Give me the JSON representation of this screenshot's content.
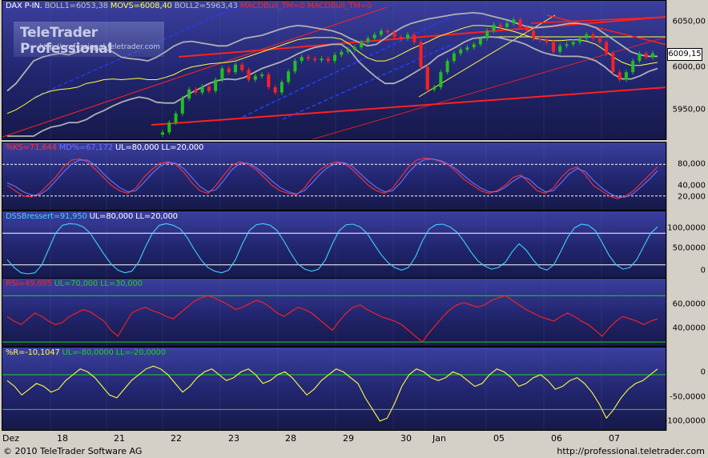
{
  "chart_data": [
    {
      "type": "candlestick",
      "header": {
        "symbol": "DAX P-IN.",
        "boll1": "BOLL1=6053,38",
        "movs": "MOVS=6008,40",
        "boll2": "BOLL2=5963,43",
        "macd1": "MACDBull_TM=0",
        "macd2": "MACDBull_TM=0"
      },
      "last_price": "6009,15",
      "y_ticks": [
        "6050,00",
        "6000,00",
        "5950,00"
      ],
      "ylim": [
        5900,
        6065
      ],
      "close": [
        5905,
        5918,
        5930,
        5950,
        5962,
        5958,
        5966,
        5960,
        5975,
        5990,
        5985,
        5995,
        5988,
        5975,
        5980,
        5982,
        5965,
        5958,
        5972,
        5986,
        6000,
        6005,
        6003,
        6001,
        6003,
        6000,
        6008,
        6012,
        6015,
        6018,
        6025,
        6030,
        6035,
        6040,
        6038,
        6032,
        6030,
        6035,
        6025,
        5992,
        5962,
        5965,
        5985,
        6000,
        6010,
        6015,
        6018,
        6022,
        6030,
        6040,
        6048,
        6045,
        6050,
        6055,
        6045,
        6040,
        6030,
        6028,
        6025,
        6012,
        6020,
        6022,
        6025,
        6030,
        6035,
        6030,
        6025,
        6010,
        5985,
        5975,
        5985,
        6000,
        6010,
        6005,
        6010
      ],
      "boll_upper": [
        5960,
        5970,
        5985,
        6000,
        6005,
        6008,
        6010,
        6008,
        6012,
        6018,
        6015,
        6016,
        6012,
        6005,
        6003,
        6002,
        6000,
        6005,
        6012,
        6020,
        6025,
        6026,
        6024,
        6022,
        6020,
        6020,
        6025,
        6030,
        6032,
        6034,
        6038,
        6042,
        6045,
        6047,
        6046,
        6044,
        6042,
        6040,
        6036,
        6030,
        6025,
        6020,
        6022,
        6030,
        6038,
        6045,
        6050,
        6053,
        6056,
        6058,
        6060,
        6062,
        6063,
        6064,
        6063,
        6060,
        6057,
        6054,
        6050,
        6046,
        6044,
        6045,
        6046,
        6048,
        6050,
        6050,
        6048,
        6044,
        6036,
        6028,
        6020,
        6012,
        6008,
        6006,
        6006
      ],
      "boll_middle": [
        5930,
        5935,
        5942,
        5950,
        5956,
        5960,
        5962,
        5963,
        5965,
        5970,
        5972,
        5975,
        5976,
        5975,
        5976,
        5977,
        5975,
        5975,
        5978,
        5982,
        5988,
        5992,
        5994,
        5996,
        5997,
        5998,
        6000,
        6004,
        6008,
        6012,
        6016,
        6020,
        6024,
        6028,
        6030,
        6031,
        6031,
        6031,
        6029,
        6022,
        6012,
        6004,
        6000,
        6000,
        6004,
        6010,
        6016,
        6021,
        6026,
        6032,
        6036,
        6040,
        6044,
        6047,
        6047,
        6046,
        6044,
        6041,
        6038,
        6034,
        6030,
        6028,
        6027,
        6027,
        6028,
        6028,
        6026,
        6022,
        6014,
        6005,
        5998,
        5994,
        5994,
        5996,
        5998
      ],
      "boll_lower": [
        5900,
        5900,
        5900,
        5900,
        5907,
        5912,
        5914,
        5918,
        5918,
        5922,
        5929,
        5934,
        5940,
        5945,
        5949,
        5952,
        5950,
        5945,
        5944,
        5944,
        5951,
        5958,
        5964,
        5970,
        5974,
        5976,
        5975,
        5978,
        5984,
        5990,
        5994,
        5998,
        6003,
        6009,
        6014,
        6018,
        6020,
        6022,
        6022,
        6014,
        5999,
        5988,
        5978,
        5970,
        5970,
        5975,
        5982,
        5989,
        5996,
        6006,
        6012,
        6018,
        6025,
        6030,
        6031,
        6032,
        6031,
        6028,
        6026,
        6022,
        6016,
        6011,
        6008,
        6006,
        6006,
        6006,
        6004,
        6000,
        5992,
        5982,
        5976,
        5976,
        5980,
        5986,
        5990
      ]
    },
    {
      "type": "line",
      "header": {
        "ks": "%KS=71,644",
        "md": "MD%=67,172",
        "ul": "UL=80,000",
        "ll": "LL=20,000"
      },
      "y_ticks": [
        "80,000",
        "40,000",
        "20,000"
      ],
      "ylim": [
        0,
        100
      ],
      "series": [
        {
          "name": "%KS",
          "color": "#ff3030",
          "values": [
            40,
            30,
            20,
            18,
            25,
            40,
            55,
            75,
            88,
            90,
            85,
            70,
            55,
            40,
            30,
            25,
            35,
            55,
            70,
            82,
            85,
            80,
            65,
            45,
            30,
            25,
            40,
            60,
            78,
            85,
            80,
            70,
            55,
            40,
            30,
            25,
            22,
            35,
            55,
            70,
            80,
            85,
            82,
            70,
            55,
            40,
            30,
            25,
            35,
            55,
            75,
            88,
            92,
            90,
            85,
            78,
            65,
            50,
            40,
            30,
            25,
            30,
            40,
            55,
            60,
            45,
            30,
            25,
            35,
            55,
            70,
            75,
            60,
            40,
            30,
            20,
            15,
            20,
            30,
            45,
            60,
            75
          ]
        },
        {
          "name": "MD%",
          "color": "#7070ff",
          "values": [
            45,
            38,
            28,
            22,
            22,
            32,
            48,
            65,
            80,
            88,
            88,
            78,
            62,
            48,
            36,
            28,
            30,
            45,
            62,
            76,
            83,
            82,
            72,
            55,
            38,
            28,
            32,
            50,
            70,
            82,
            82,
            74,
            62,
            48,
            36,
            28,
            24,
            30,
            45,
            62,
            75,
            82,
            83,
            76,
            62,
            48,
            36,
            28,
            30,
            45,
            65,
            80,
            89,
            90,
            87,
            80,
            70,
            57,
            45,
            35,
            28,
            28,
            36,
            48,
            57,
            52,
            38,
            28,
            30,
            45,
            62,
            72,
            66,
            50,
            36,
            25,
            18,
            18,
            25,
            38,
            52,
            68
          ]
        }
      ]
    },
    {
      "type": "line",
      "header": {
        "dss": "DSSBressert=91,950",
        "ul": "UL=80,000",
        "ll": "LL=20,000"
      },
      "y_ticks": [
        "100,0000",
        "50,0000",
        "0"
      ],
      "ylim": [
        0,
        100
      ],
      "series": [
        {
          "name": "DSSBressert",
          "color": "#40d0ff",
          "values": [
            30,
            15,
            5,
            3,
            5,
            20,
            50,
            80,
            95,
            98,
            97,
            92,
            80,
            60,
            40,
            22,
            10,
            5,
            8,
            25,
            55,
            80,
            95,
            98,
            95,
            88,
            72,
            50,
            30,
            15,
            8,
            5,
            10,
            30,
            60,
            85,
            96,
            98,
            95,
            85,
            65,
            42,
            22,
            12,
            8,
            12,
            30,
            60,
            85,
            96,
            97,
            92,
            80,
            60,
            40,
            25,
            15,
            10,
            15,
            35,
            65,
            88,
            96,
            97,
            92,
            82,
            65,
            45,
            28,
            18,
            12,
            15,
            25,
            45,
            60,
            48,
            30,
            15,
            10,
            20,
            45,
            72,
            90,
            97,
            95,
            85,
            62,
            38,
            20,
            12,
            15,
            30,
            55,
            80,
            92
          ]
        }
      ]
    },
    {
      "type": "line",
      "header": {
        "rsi": "RSI=49,695",
        "ul": "UL=70,000",
        "ll": "LL=30,000"
      },
      "y_ticks": [
        "60,0000",
        "40,0000"
      ],
      "ylim": [
        28,
        75
      ],
      "series": [
        {
          "name": "RSI",
          "color": "#ff2020",
          "values": [
            52,
            48,
            45,
            50,
            55,
            52,
            48,
            45,
            47,
            52,
            55,
            58,
            56,
            52,
            48,
            40,
            35,
            45,
            55,
            58,
            60,
            57,
            55,
            52,
            50,
            55,
            60,
            65,
            68,
            70,
            68,
            65,
            62,
            58,
            60,
            63,
            66,
            64,
            60,
            55,
            52,
            56,
            60,
            58,
            55,
            50,
            45,
            40,
            48,
            55,
            60,
            62,
            58,
            55,
            52,
            50,
            48,
            45,
            40,
            35,
            30,
            38,
            45,
            52,
            58,
            62,
            64,
            62,
            60,
            62,
            66,
            68,
            70,
            66,
            62,
            58,
            55,
            52,
            50,
            48,
            52,
            55,
            52,
            48,
            45,
            40,
            35,
            42,
            48,
            52,
            50,
            48,
            45,
            48,
            50
          ]
        }
      ]
    },
    {
      "type": "line",
      "header": {
        "r": "%R=-10,1047",
        "ul": "UL=-80,0000",
        "ll": "LL=-20,0000"
      },
      "y_ticks": [
        "0",
        "-50,0000",
        "-100,0000"
      ],
      "ylim": [
        -110,
        5
      ],
      "series": [
        {
          "name": "%R",
          "color": "#ffff40",
          "values": [
            -30,
            -40,
            -55,
            -45,
            -35,
            -40,
            -50,
            -45,
            -30,
            -20,
            -10,
            -15,
            -25,
            -40,
            -55,
            -60,
            -45,
            -30,
            -20,
            -10,
            -5,
            -10,
            -20,
            -35,
            -50,
            -40,
            -25,
            -15,
            -10,
            -20,
            -30,
            -25,
            -15,
            -10,
            -20,
            -35,
            -30,
            -20,
            -15,
            -25,
            -40,
            -55,
            -45,
            -30,
            -20,
            -10,
            -15,
            -25,
            -35,
            -60,
            -80,
            -100,
            -95,
            -70,
            -40,
            -20,
            -10,
            -15,
            -25,
            -30,
            -25,
            -15,
            -20,
            -30,
            -40,
            -35,
            -20,
            -10,
            -15,
            -25,
            -40,
            -35,
            -25,
            -20,
            -30,
            -45,
            -40,
            -30,
            -25,
            -35,
            -50,
            -70,
            -95,
            -80,
            -60,
            -45,
            -35,
            -30,
            -20,
            -10
          ]
        }
      ]
    }
  ],
  "x_ticks": [
    "Dez",
    "18",
    "21",
    "22",
    "23",
    "28",
    "29",
    "30",
    "Jan",
    "05",
    "06",
    "07"
  ],
  "logo": {
    "title": "TeleTrader Professional",
    "url": "http://professional.teletrader.com"
  },
  "footer": {
    "copyright": "© 2010 TeleTrader Software AG",
    "url": "http://professional.teletrader.com"
  },
  "colors": {
    "panel_top": "#3b3f9e",
    "panel_bottom": "#161949",
    "up": "#20c020",
    "down": "#ff2020",
    "trend_red": "#ff2020",
    "trend_yellow": "#ffff40",
    "trend_blue": "#2040ff",
    "boll": "#b0b0b0",
    "movs": "#ffff40"
  }
}
